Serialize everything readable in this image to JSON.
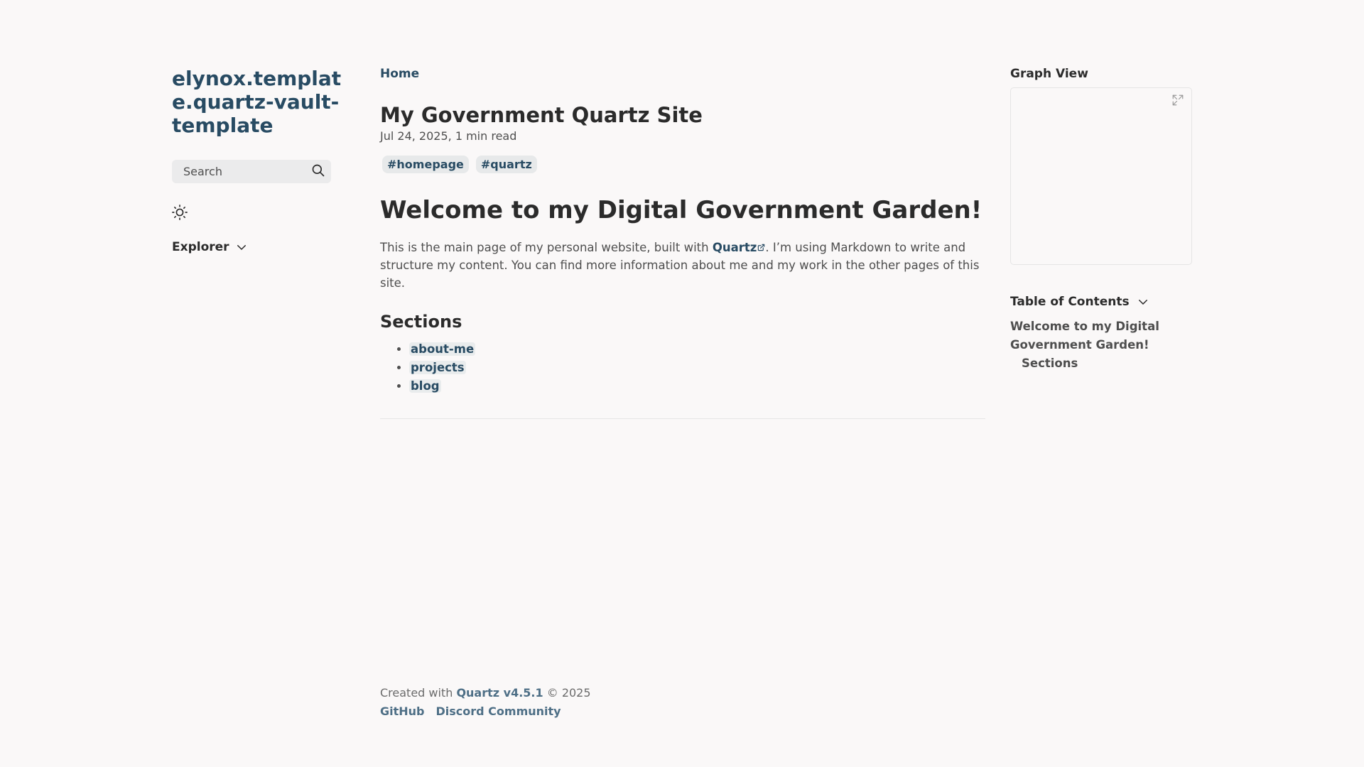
{
  "site": {
    "title": "elynox.template.quartz-vault-template"
  },
  "search": {
    "placeholder": "Search",
    "icon": "search-icon"
  },
  "theme_toggle": {
    "icon": "sun-icon"
  },
  "explorer": {
    "label": "Explorer",
    "icon": "chevron-down-icon"
  },
  "breadcrumb": {
    "home": "Home"
  },
  "page": {
    "title": "My Government Quartz Site",
    "date": "Jul 24, 2025",
    "date_sep": ",",
    "read_time": "1 min read",
    "tags": [
      "#homepage",
      "#quartz"
    ]
  },
  "content": {
    "heading": "Welcome to my Digital Government Garden!",
    "para_before": "This is the main page of my personal website, built with ",
    "para_link": "Quartz",
    "para_after": ". I’m using Markdown to write and structure my content. You can find more information about me and my work in the other pages of this site.",
    "sections_heading": "Sections",
    "sections": [
      "about-me",
      "projects",
      "blog"
    ]
  },
  "right": {
    "graph_title": "Graph View",
    "graph_expand_icon": "expand-icon",
    "toc_title": "Table of Contents",
    "toc_items": [
      "Welcome to my Digital Government Garden!",
      "Sections"
    ]
  },
  "footer": {
    "created_prefix": "Created with ",
    "quartz_version": "Quartz v4.5.1",
    "copyright": " © 2025",
    "links": [
      "GitHub",
      "Discord Community"
    ]
  },
  "colors": {
    "accent": "#284b63",
    "background": "#faf8f8",
    "text": "#2b2b2b",
    "muted": "#4e4e4e"
  }
}
